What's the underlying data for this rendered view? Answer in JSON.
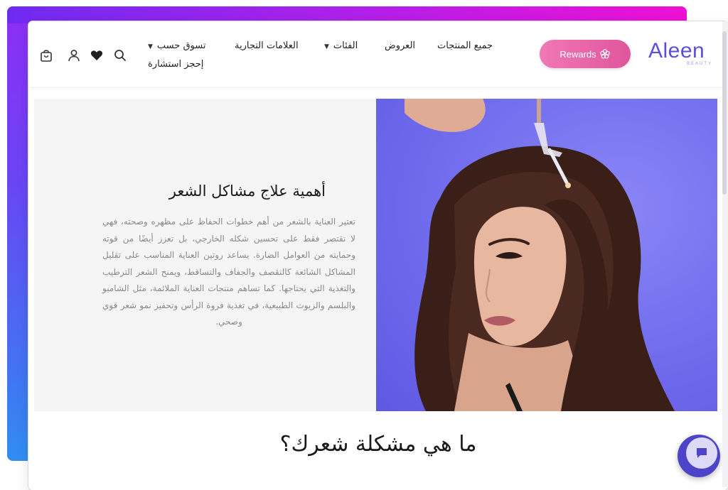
{
  "header": {
    "logo_text": "Aleen",
    "logo_sub": "BEAUTY",
    "rewards_label": "Rewards",
    "nav": {
      "all_products": "جميع المنتجات",
      "offers": "العروض",
      "categories": "الفئات",
      "brands": "العلامات التجارية",
      "shop_by": "تسوق حسب",
      "book_consultation": "إحجز استشارة"
    },
    "icons": [
      "search-icon",
      "heart-icon",
      "user-icon",
      "cart-icon"
    ]
  },
  "hero": {
    "title": "أهمية علاج مشاكل الشعر",
    "body": "تعتبر العناية بالشعر من أهم خطوات الحفاظ على مظهره وصحته، فهي لا تقتصر فقط على تحسين شكله الخارجي، بل تعزز أيضًا من قوته وحمايته من العوامل الضارة. يساعد روتين العناية المناسب على تقليل المشاكل الشائعة كالتقصف والجفاف والتساقط، ويمنح الشعر الترطيب والتغذية التي يحتاجها. كما تساهم منتجات العناية الملائمة، مثل الشامبو والبلسم والزيوت الطبيعية، في تغذية فروة الرأس وتحفيز نمو شعر قوي وصحي.",
    "image": "woman-applying-hair-serum"
  },
  "section": {
    "title": "ما هي مشكلة شعرك؟"
  },
  "colors": {
    "brand": "#5b4fd9",
    "rewards": "#e86aab",
    "hero_bg": "#7470ef",
    "chat": "#4c44c9"
  }
}
